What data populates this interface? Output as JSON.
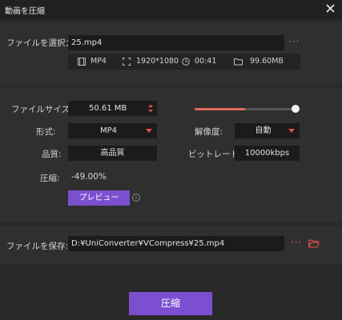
{
  "window": {
    "title": "動画を圧縮"
  },
  "file": {
    "label": "ファイルを選択：",
    "name": "25.mp4",
    "more": "···"
  },
  "info": {
    "format": "MP4",
    "resolution": "1920*1080",
    "duration": "00:41",
    "size": "99.60MB"
  },
  "settings": {
    "filesize_label": "ファイルサイズ:",
    "filesize_value": "50.61  MB",
    "slider_level": 0.48,
    "format_label": "形式:",
    "format_value": "MP4",
    "resolution_label": "解像度:",
    "resolution_value": "自動",
    "quality_label": "品質:",
    "quality_value": "高品質",
    "bitrate_label": "ビットレート",
    "bitrate_value": "10000kbps",
    "compress_label": "圧縮:",
    "compress_value": "-49.00%",
    "preview_label": "プレビュー"
  },
  "save": {
    "label": "ファイルを保存:",
    "path": "D:¥UniConverter¥VCompress¥25.mp4",
    "more": "···"
  },
  "actions": {
    "compress_label": "圧縮"
  },
  "colors": {
    "accent": "#7b4fd0",
    "highlight": "#e26b5e"
  }
}
